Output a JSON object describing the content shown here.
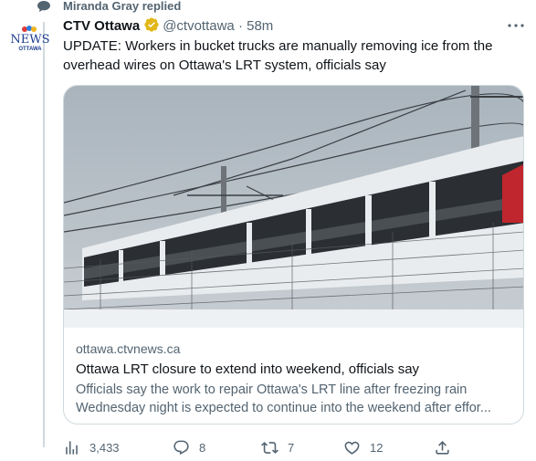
{
  "reply_context": {
    "text": "Miranda Gray replied"
  },
  "tweet": {
    "author_name": "CTV Ottawa",
    "handle": "@ctvottawa",
    "separator": "·",
    "time": "58m",
    "avatar_logo": {
      "line1": "NEWS",
      "line2": "OTTAWA"
    },
    "text": "UPDATE: Workers in bucket trucks are manually removing ice from the overhead wires on Ottawa's LRT system, officials say"
  },
  "card": {
    "image_icon": "lrt-train-photo",
    "domain": "ottawa.ctvnews.ca",
    "title": "Ottawa LRT closure to extend into weekend, officials say",
    "description_line1": "Officials say the work to repair Ottawa's LRT line after freezing rain",
    "description_line2": "Wednesday night is expected to continue into the weekend after effor..."
  },
  "actions": {
    "views": "3,433",
    "replies": "8",
    "retweets": "7",
    "likes": "12"
  },
  "colors": {
    "secondary_text": "#536471",
    "primary_text": "#0f1419",
    "verified": "#e2b719",
    "border": "#cfd9de"
  }
}
